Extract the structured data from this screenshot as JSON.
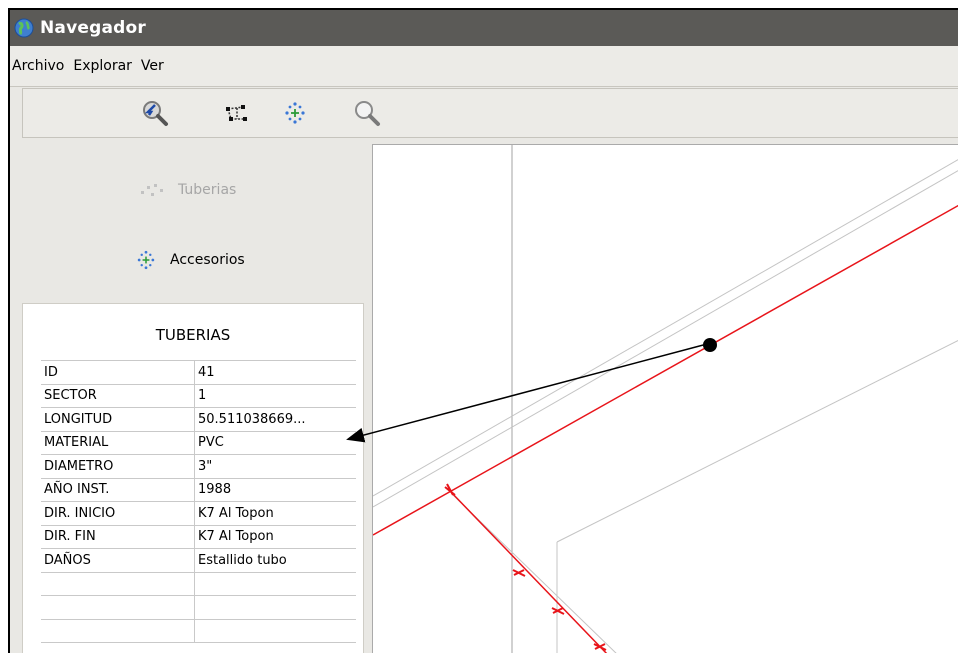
{
  "window": {
    "title": "Navegador"
  },
  "menu": [
    "Archivo",
    "Explorar",
    "Ver"
  ],
  "toolbar": {
    "icons": [
      "select-feature-icon",
      "network-icon",
      "accessories-icon",
      "zoom-icon"
    ]
  },
  "layers": {
    "tuberias_label": "Tuberias",
    "accesorios_label": "Accesorios"
  },
  "info_panel": {
    "title": "TUBERIAS",
    "rows": [
      {
        "key": "ID",
        "value": "41"
      },
      {
        "key": "SECTOR",
        "value": "1"
      },
      {
        "key": "LONGITUD",
        "value": "50.511038669..."
      },
      {
        "key": "MATERIAL",
        "value": "PVC"
      },
      {
        "key": "DIAMETRO",
        "value": "3\""
      },
      {
        "key": "AÑO INST.",
        "value": "1988"
      },
      {
        "key": "DIR. INICIO",
        "value": "K7 Al Topon"
      },
      {
        "key": "DIR. FIN",
        "value": "K7 Al Topon"
      },
      {
        "key": "DAÑOS",
        "value": "Estallido tubo"
      },
      {
        "key": "",
        "value": ""
      },
      {
        "key": "",
        "value": ""
      },
      {
        "key": "",
        "value": ""
      }
    ]
  },
  "colors": {
    "titlebar": "#5b5a57",
    "pipe_selected": "#e8141a",
    "pipe_other": "#bdbdbd"
  }
}
